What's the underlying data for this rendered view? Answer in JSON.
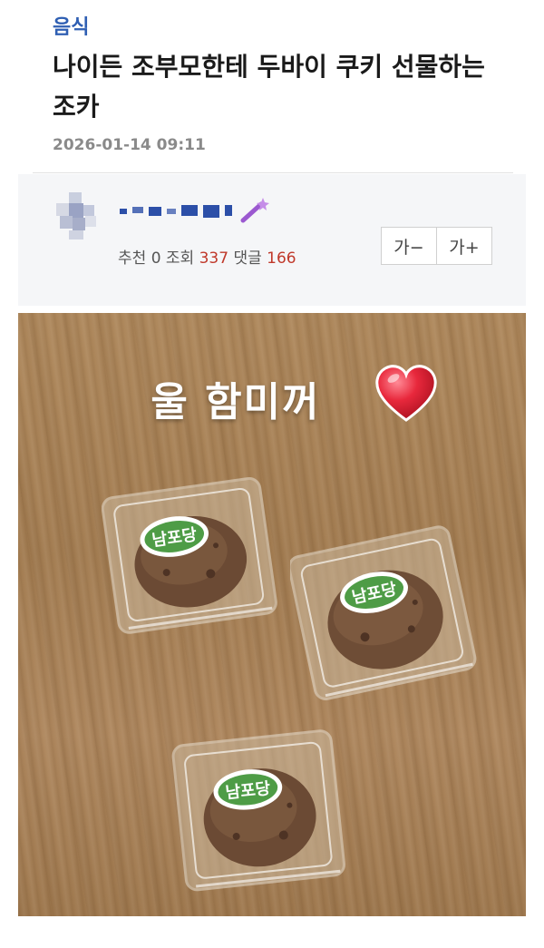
{
  "post": {
    "category": "음식",
    "title": "나이든 조부모한테 두바이 쿠키 선물하는 조카",
    "date": "2026-01-14 09:11"
  },
  "meta": {
    "recommend_label": "추천",
    "recommend_count": "0",
    "views_label": "조회",
    "views_count": "337",
    "comments_label": "댓글",
    "comments_count": "166",
    "font_decrease_label": "가−",
    "font_increase_label": "가+"
  },
  "photo": {
    "caption": "울 함미꺼",
    "sticker_text": "남포당"
  },
  "colors": {
    "category": "#2f5fb3",
    "count_accent": "#c0392b",
    "sticker_green": "#3d8b3a"
  }
}
